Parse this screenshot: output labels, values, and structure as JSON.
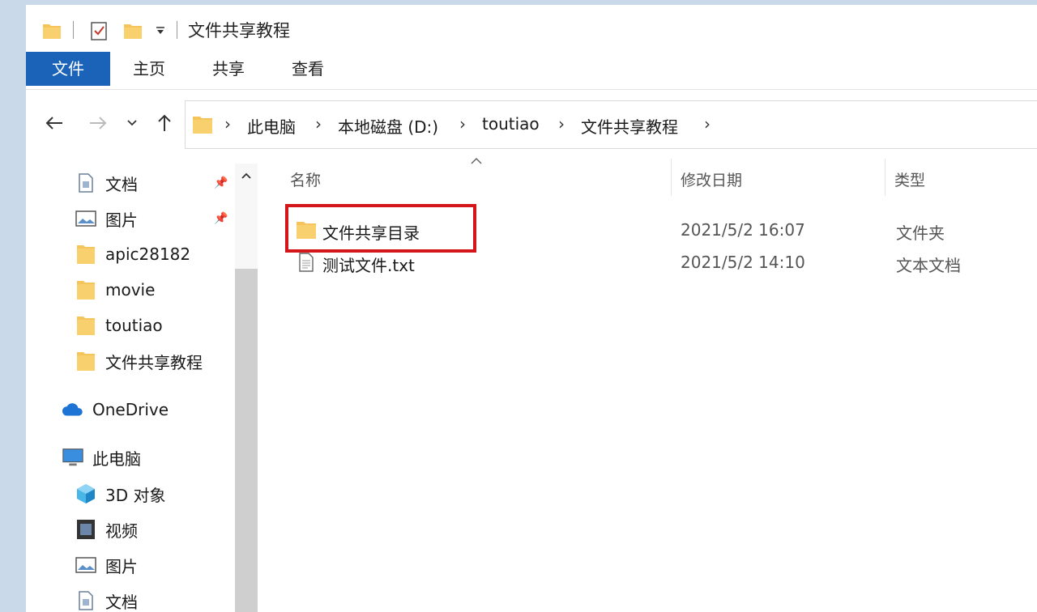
{
  "window": {
    "title": "文件共享教程"
  },
  "ribbon": {
    "tabs": [
      "文件",
      "主页",
      "共享",
      "查看"
    ],
    "accent": "#1a63b8"
  },
  "address": {
    "crumbs": [
      "此电脑",
      "本地磁盘 (D:)",
      "toutiao",
      "文件共享教程"
    ]
  },
  "sidebar": {
    "quick_access": [
      {
        "label": "文档",
        "icon": "document-icon",
        "pinned": true
      },
      {
        "label": "图片",
        "icon": "picture-icon",
        "pinned": true
      },
      {
        "label": "apic28182",
        "icon": "folder-icon"
      },
      {
        "label": "movie",
        "icon": "folder-icon"
      },
      {
        "label": "toutiao",
        "icon": "folder-icon"
      },
      {
        "label": "文件共享教程",
        "icon": "folder-icon"
      }
    ],
    "onedrive": "OneDrive",
    "this_pc": "此电脑",
    "pc_items": [
      {
        "label": "3D 对象",
        "icon": "cube-icon"
      },
      {
        "label": "视频",
        "icon": "video-icon"
      },
      {
        "label": "图片",
        "icon": "picture-icon"
      },
      {
        "label": "文档",
        "icon": "document-icon"
      }
    ]
  },
  "columns": {
    "name": "名称",
    "modified": "修改日期",
    "type": "类型"
  },
  "files": [
    {
      "name": "文件共享目录",
      "modified": "2021/5/2 16:07",
      "type": "文件夹",
      "icon": "folder-icon",
      "highlighted": true
    },
    {
      "name": "测试文件.txt",
      "modified": "2021/5/2 14:10",
      "type": "文本文档",
      "icon": "text-file-icon"
    }
  ],
  "colors": {
    "highlight_border": "#d4161b",
    "folder": "#f5c45a"
  }
}
